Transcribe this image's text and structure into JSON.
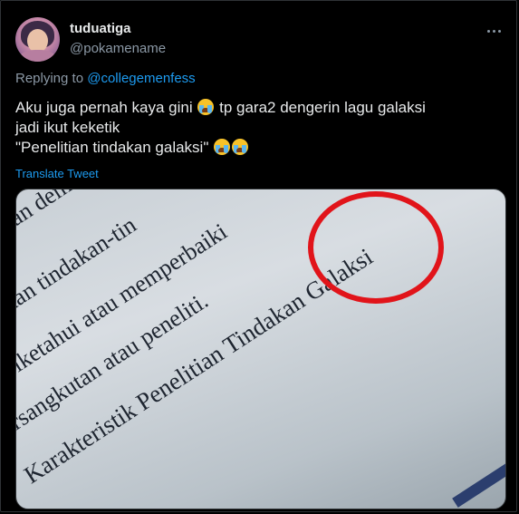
{
  "user": {
    "display_name": "tuduatiga",
    "handle": "@pokamename"
  },
  "reply": {
    "prefix": "Replying to ",
    "mention": "@collegemenfess"
  },
  "tweet": {
    "line1_part1": "Aku juga pernah kaya gini",
    "line1_part2": " tp gara2 dengerin lagu galaksi",
    "line2": "jadi ikut keketik",
    "line3": "\"Penelitian tindakan galaksi\"",
    "emoji_name": "loudly-crying-face"
  },
  "translate_label": "Translate Tweet",
  "photo": {
    "lines": [
      "gan dem",
      "akan tindakan-tin",
      "Diketahui atau memperbaiki",
      "ersangkutan atau peneliti.",
      "Karakteristik Penelitian Tindakan Galaksi"
    ],
    "highlight_color": "#e1141a"
  },
  "colors": {
    "background": "#000000",
    "accent": "#1d9bf0",
    "muted": "#8b98a5",
    "text": "#e7e9ea"
  }
}
